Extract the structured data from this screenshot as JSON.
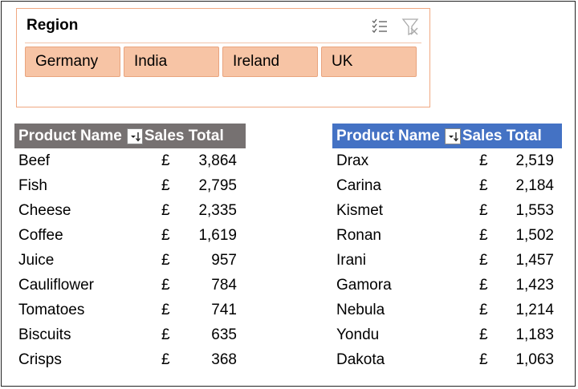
{
  "slicer": {
    "title": "Region",
    "icons": [
      "multi-select-icon",
      "clear-filter-icon"
    ],
    "items": [
      {
        "label": "Germany"
      },
      {
        "label": "India"
      },
      {
        "label": "Ireland"
      },
      {
        "label": "UK"
      }
    ]
  },
  "table_products": {
    "col_name": "Product Name",
    "col_sales": "Sales Total",
    "header_color": "#767171",
    "rows": [
      {
        "name": "Beef",
        "cur": "£",
        "value": "3,864"
      },
      {
        "name": "Fish",
        "cur": "£",
        "value": "2,795"
      },
      {
        "name": "Cheese",
        "cur": "£",
        "value": "2,335"
      },
      {
        "name": "Coffee",
        "cur": "£",
        "value": "1,619"
      },
      {
        "name": "Juice",
        "cur": "£",
        "value": "957"
      },
      {
        "name": "Cauliflower",
        "cur": "£",
        "value": "784"
      },
      {
        "name": "Tomatoes",
        "cur": "£",
        "value": "741"
      },
      {
        "name": "Biscuits",
        "cur": "£",
        "value": "635"
      },
      {
        "name": "Crisps",
        "cur": "£",
        "value": "368"
      }
    ]
  },
  "table_people": {
    "col_name": "Product Name",
    "col_sales": "Sales Total",
    "header_color": "#4472c4",
    "rows": [
      {
        "name": "Drax",
        "cur": "£",
        "value": "2,519"
      },
      {
        "name": "Carina",
        "cur": "£",
        "value": "2,184"
      },
      {
        "name": "Kismet",
        "cur": "£",
        "value": "1,553"
      },
      {
        "name": "Ronan",
        "cur": "£",
        "value": "1,502"
      },
      {
        "name": "Irani",
        "cur": "£",
        "value": "1,457"
      },
      {
        "name": "Gamora",
        "cur": "£",
        "value": "1,423"
      },
      {
        "name": "Nebula",
        "cur": "£",
        "value": "1,214"
      },
      {
        "name": "Yondu",
        "cur": "£",
        "value": "1,183"
      },
      {
        "name": "Dakota",
        "cur": "£",
        "value": "1,063"
      }
    ]
  }
}
